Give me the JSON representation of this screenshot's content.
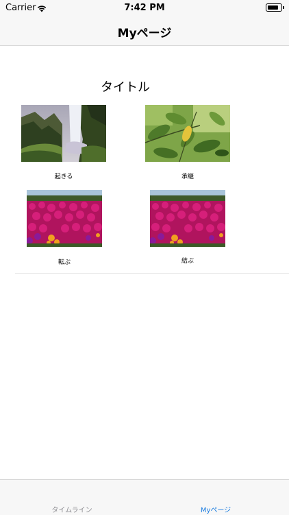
{
  "status": {
    "carrier": "Carrier",
    "time": "7:42 PM"
  },
  "nav": {
    "title": "Myページ"
  },
  "main": {
    "title": "タイトル",
    "items": [
      {
        "label": "起きる",
        "image": "waterfall-photo"
      },
      {
        "label": "承継",
        "image": "leaves-photo"
      },
      {
        "label": "転ぶ",
        "image": "flowers-photo"
      },
      {
        "label": "結ぶ",
        "image": "flowers-photo"
      }
    ]
  },
  "tabs": [
    {
      "label": "タイムライン",
      "active": false
    },
    {
      "label": "Myページ",
      "active": true
    }
  ],
  "colors": {
    "accent": "#1a7ce0",
    "inactive": "#8e8e93",
    "bar": "#f7f7f7"
  }
}
